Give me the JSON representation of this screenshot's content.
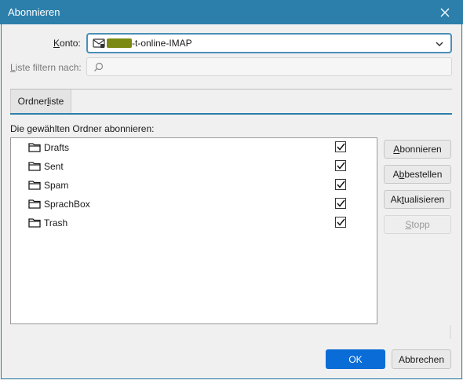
{
  "window": {
    "title": "Abonnieren"
  },
  "account": {
    "label_pre": "",
    "label_u": "K",
    "label_post": "onto:",
    "value_suffix": "-t-online-IMAP"
  },
  "filter": {
    "label_u": "L",
    "label_post": "iste filtern nach:",
    "placeholder": ""
  },
  "tabs": {
    "folder_list_pre": "Ordner",
    "folder_list_u": "l",
    "folder_list_post": "iste"
  },
  "list": {
    "caption": "Die gewählten Ordner abonnieren:",
    "folders": [
      {
        "name": "Drafts",
        "checked": true
      },
      {
        "name": "Sent",
        "checked": true
      },
      {
        "name": "Spam",
        "checked": true
      },
      {
        "name": "SprachBox",
        "checked": true
      },
      {
        "name": "Trash",
        "checked": true
      }
    ]
  },
  "buttons": {
    "subscribe_u": "A",
    "subscribe_post": "bonnieren",
    "unsubscribe_pre": "A",
    "unsubscribe_u": "b",
    "unsubscribe_post": "bestellen",
    "refresh_pre": "Ak",
    "refresh_u": "t",
    "refresh_post": "ualisieren",
    "stop_u": "S",
    "stop_post": "topp",
    "ok": "OK",
    "cancel": "Abbrechen"
  },
  "colors": {
    "titlebar": "#2c7fab",
    "accent": "#0a6cd6",
    "redaction": "#7b8a12"
  }
}
